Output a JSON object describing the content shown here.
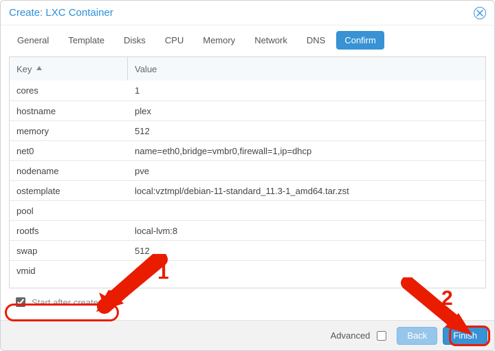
{
  "window": {
    "title": "Create: LXC Container"
  },
  "tabs": [
    "General",
    "Template",
    "Disks",
    "CPU",
    "Memory",
    "Network",
    "DNS",
    "Confirm"
  ],
  "active_tab": "Confirm",
  "grid": {
    "columns": {
      "key": "Key",
      "value": "Value"
    },
    "sort": "asc",
    "rows": [
      {
        "key": "cores",
        "value": "1"
      },
      {
        "key": "hostname",
        "value": "plex"
      },
      {
        "key": "memory",
        "value": "512"
      },
      {
        "key": "net0",
        "value": "name=eth0,bridge=vmbr0,firewall=1,ip=dhcp"
      },
      {
        "key": "nodename",
        "value": "pve"
      },
      {
        "key": "ostemplate",
        "value": "local:vztmpl/debian-11-standard_11.3-1_amd64.tar.zst"
      },
      {
        "key": "pool",
        "value": ""
      },
      {
        "key": "rootfs",
        "value": "local-lvm:8"
      },
      {
        "key": "swap",
        "value": "512"
      },
      {
        "key": "vmid",
        "value": "100"
      }
    ]
  },
  "start_after_created": {
    "label": "Start after created",
    "checked": true
  },
  "footer": {
    "advanced_label": "Advanced",
    "advanced_checked": false,
    "back_label": "Back",
    "finish_label": "Finish"
  },
  "annotations": {
    "label1": "1",
    "label2": "2"
  }
}
